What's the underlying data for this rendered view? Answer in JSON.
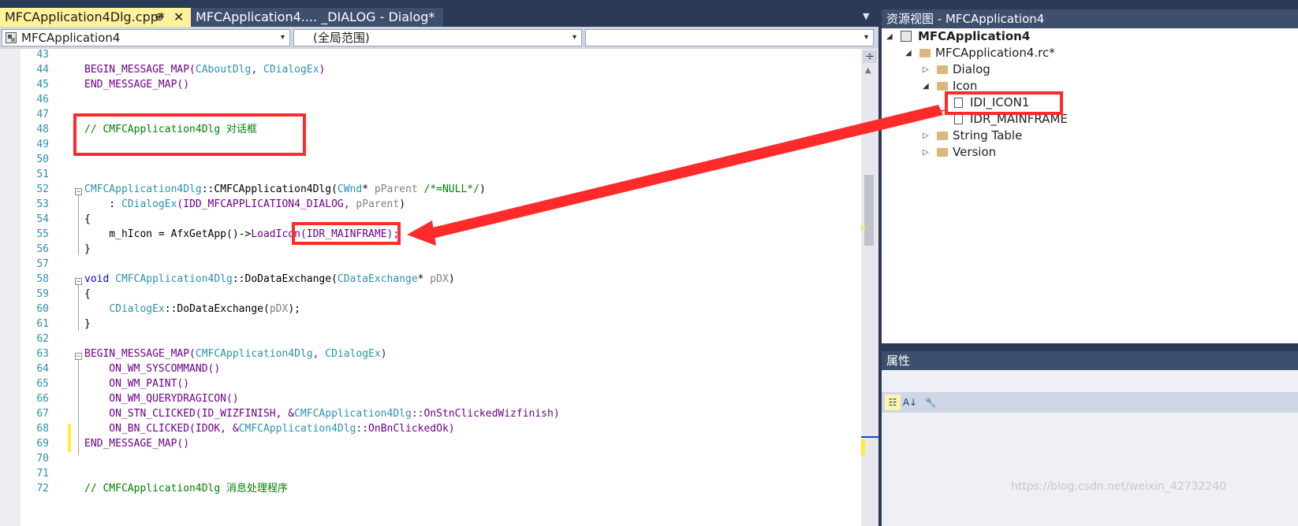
{
  "tabs": {
    "active_label": "MFCApplication4Dlg.cpp*",
    "active_pin": "⊕",
    "active_close": "✕",
    "inactive_label": "MFCApplication4.... _DIALOG - Dialog*",
    "dropdown": "▼"
  },
  "navbar": {
    "project": "MFCApplication4",
    "scope": "(全局范围)",
    "member": "",
    "arrow": "▾"
  },
  "code_lines": [
    {
      "n": "43"
    },
    {
      "n": "44"
    },
    {
      "n": "45"
    },
    {
      "n": "46"
    },
    {
      "n": "47"
    },
    {
      "n": "48"
    },
    {
      "n": "49"
    },
    {
      "n": "50"
    },
    {
      "n": "51"
    },
    {
      "n": "52"
    },
    {
      "n": "53"
    },
    {
      "n": "54"
    },
    {
      "n": "55"
    },
    {
      "n": "56"
    },
    {
      "n": "57"
    },
    {
      "n": "58"
    },
    {
      "n": "59"
    },
    {
      "n": "60"
    },
    {
      "n": "61"
    },
    {
      "n": "62"
    },
    {
      "n": "63"
    },
    {
      "n": "64"
    },
    {
      "n": "65"
    },
    {
      "n": "66"
    },
    {
      "n": "67"
    },
    {
      "n": "68"
    },
    {
      "n": "69"
    },
    {
      "n": "70"
    },
    {
      "n": "71"
    },
    {
      "n": "72"
    }
  ],
  "code": {
    "l44_a": "BEGIN_MESSAGE_MAP(",
    "l44_b": "CAboutDlg",
    "l44_c": ", ",
    "l44_d": "CDialogEx",
    "l44_e": ")",
    "l45": "END_MESSAGE_MAP()",
    "l48": "// CMFCApplication4Dlg 对话框",
    "l52_a": "CMFCApplication4Dlg",
    "l52_b": "::CMFCApplication4Dlg(",
    "l52_c": "CWnd",
    "l52_d": "* ",
    "l52_e": "pParent",
    "l52_f": " /*=NULL*/",
    "l52_g": ")",
    "l53_a": "    : ",
    "l53_b": "CDialogEx",
    "l53_c": "(IDD_MFCAPPLICATION4_DIALOG, ",
    "l53_d": "pParent",
    "l53_e": ")",
    "l54": "{",
    "l55_a": "    m_hIcon = AfxGetApp()->",
    "l55_b": "LoadIcon",
    "l55_c": "(IDR_MAINFRAME);",
    "l56": "}",
    "l58_a": "void",
    "l58_b": " ",
    "l58_c": "CMFCApplication4Dlg",
    "l58_d": "::DoDataExchange(",
    "l58_e": "CDataExchange",
    "l58_f": "* ",
    "l58_g": "pDX",
    "l58_h": ")",
    "l59": "{",
    "l60_a": "    ",
    "l60_b": "CDialogEx",
    "l60_c": "::DoDataExchange(",
    "l60_d": "pDX",
    "l60_e": ");",
    "l61": "}",
    "l63_a": "BEGIN_MESSAGE_MAP(",
    "l63_b": "CMFCApplication4Dlg",
    "l63_c": ", ",
    "l63_d": "CDialogEx",
    "l63_e": ")",
    "l64": "    ON_WM_SYSCOMMAND()",
    "l65": "    ON_WM_PAINT()",
    "l66": "    ON_WM_QUERYDRAGICON()",
    "l67_a": "    ON_STN_CLICKED(ID_WIZFINISH, &",
    "l67_b": "CMFCApplication4Dlg",
    "l67_c": "::OnStnClickedWizfinish)",
    "l68_a": "    ON_BN_CLICKED(IDOK, &",
    "l68_b": "CMFCApplication4Dlg",
    "l68_c": "::OnBnClickedOk)",
    "l69": "END_MESSAGE_MAP()",
    "l72": "// CMFCApplication4Dlg 消息处理程序"
  },
  "fold_symbol": "−",
  "split_icon": "÷",
  "scroll_up": "▲",
  "resource_view": {
    "title": "资源视图 - MFCApplication4",
    "project": "MFCApplication4",
    "rc_file": "MFCApplication4.rc*",
    "dialog": "Dialog",
    "icon": "Icon",
    "icon_item_1": "IDI_ICON1",
    "icon_item_2": "IDR_MAINFRAME",
    "string_table": "String Table",
    "version": "Version",
    "expanded": "◢",
    "collapsed": "▷"
  },
  "properties": {
    "title": "属性",
    "btn_categorized": "☷",
    "btn_alpha": "A↓",
    "btn_props": "🔧"
  },
  "watermark": "https://blog.csdn.net/weixin_42732240",
  "colors": {
    "highlight_red": "#ff2a2a",
    "tab_active": "#fff29d",
    "chrome_dark": "#2b3a55",
    "keyword_blue": "#0000ff",
    "type_teal": "#2b91af",
    "macro_purple": "#6f008a",
    "comment_green": "#008000"
  }
}
